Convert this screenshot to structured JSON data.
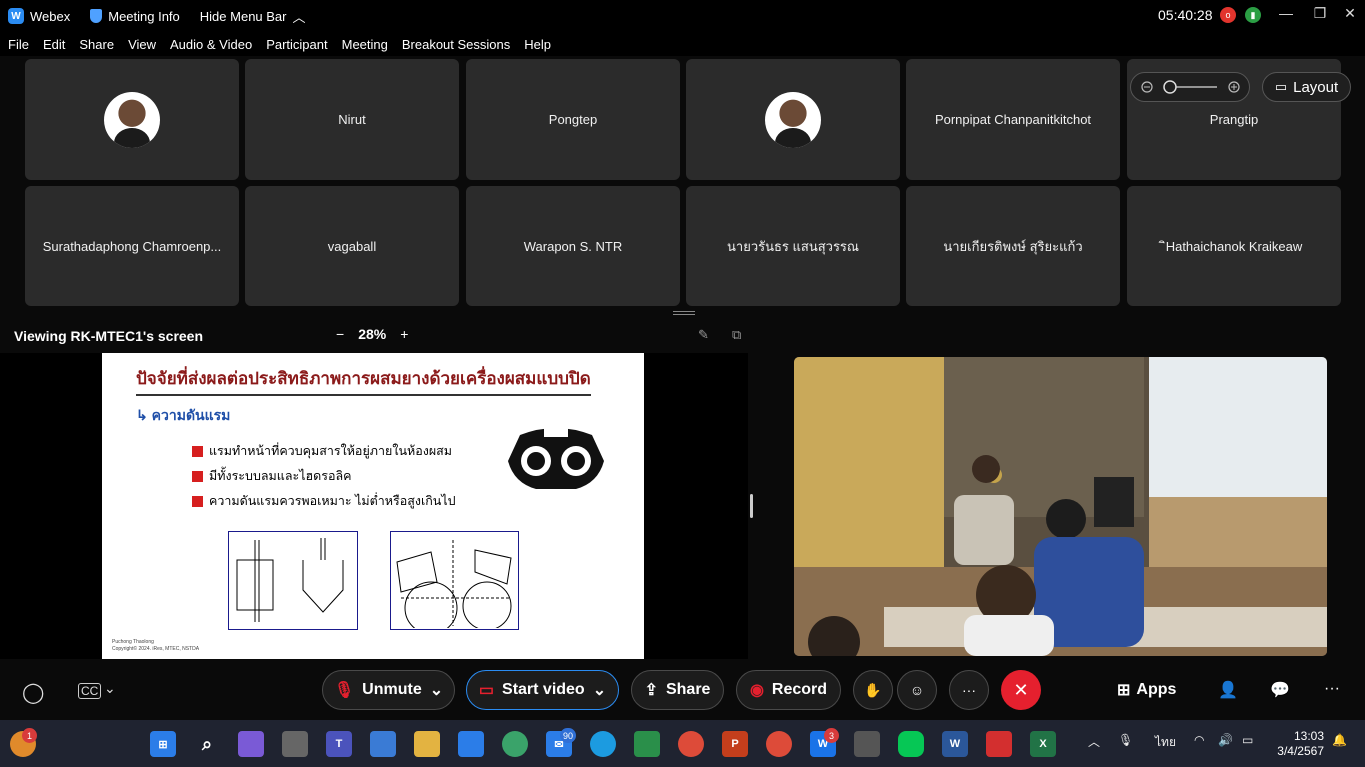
{
  "titlebar": {
    "app_name": "Webex",
    "meeting_info": "Meeting Info",
    "hide_menu": "Hide Menu Bar",
    "time": "05:40:28",
    "rec_badge": "o"
  },
  "menu": [
    "File",
    "Edit",
    "Share",
    "View",
    "Audio & Video",
    "Participant",
    "Meeting",
    "Breakout Sessions",
    "Help"
  ],
  "participants_row1": [
    "",
    "Nirut",
    "Pongtep",
    "",
    "Pornpipat Chanpanitkitchot",
    "Prangtip"
  ],
  "participants_row2": [
    "Surathadaphong Chamroenp...",
    "vagaball",
    "Warapon S. NTR",
    "นายวรันธร แสนสุวรรณ",
    "นายเกียรติพงษ์ สุริยะแก้ว",
    "ิHathaichanok Kraikeaw"
  ],
  "layout_label": "Layout",
  "viewing": {
    "label": "Viewing RK-MTEC1's screen",
    "zoom": "28%",
    "minus": "−",
    "plus": "+"
  },
  "slide": {
    "title": "ปัจจัยที่ส่งผลต่อประสิทธิภาพการผสมยางด้วยเครื่องผสมแบบปิด",
    "subtitle": "ความดันแรม",
    "bullets": [
      "แรมทำหน้าที่ควบคุมสารให้อยู่ภายในห้องผสม",
      "มีทั้งระบบลมและไฮดรอลิค",
      "ความดันแรมควรพอเหมาะ ไม่ต่ำหรือสูงเกินไป"
    ],
    "footer1": "Puchong Thaolong",
    "footer2": "Copyright© 2024. iRes, MTEC, NSTDA"
  },
  "controls": {
    "unmute": "Unmute",
    "start_video": "Start video",
    "share": "Share",
    "record": "Record",
    "apps": "Apps"
  },
  "taskbar": {
    "teams_badge": "1",
    "mail_badge": "90",
    "webex_badge": "3",
    "lang": "ไทย",
    "time": "13:03",
    "date": "3/4/2567"
  }
}
